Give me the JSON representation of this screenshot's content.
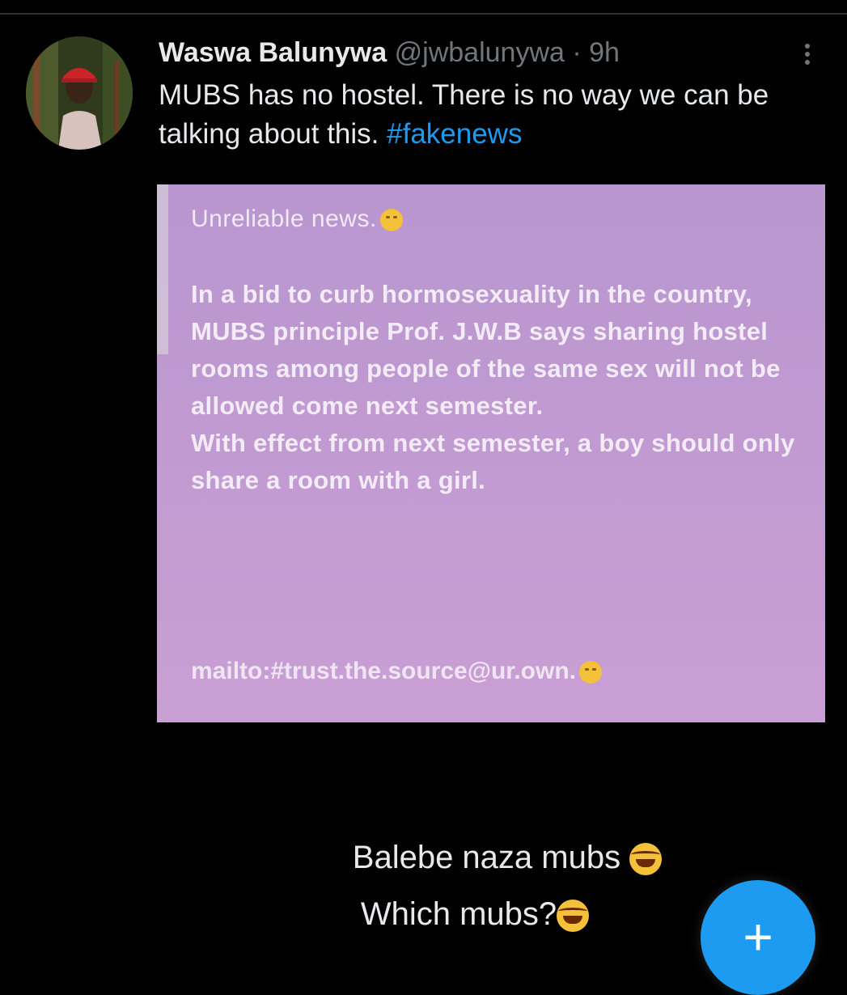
{
  "tweet": {
    "author_name": "Waswa Balunywa",
    "author_handle": "@jwbalunywa",
    "separator": "·",
    "time": "9h",
    "text": "MUBS has no hostel. There is no way we can be talking about this. ",
    "hashtag": "#fakenews"
  },
  "media": {
    "card_title": "Unreliable news.",
    "card_body": [
      "In a bid to curb hormosexuality in the country, MUBS principle Prof. J.W.B says sharing hostel rooms among people of the same sex will not be allowed come next semester.",
      "With effect from next semester, a boy should only share a room with a girl."
    ],
    "card_mail": "mailto:#trust.the.source@ur.own.",
    "caption_line_1": "Balebe naza mubs ",
    "caption_line_2": "Which mubs?"
  },
  "fab": {
    "label": "+"
  },
  "icons": {
    "more": "more-vertical-icon",
    "compose": "plus-icon"
  },
  "colors": {
    "background": "#000000",
    "hashtag": "#1d9bf0",
    "fab": "#1d9bf0",
    "card_purple": "#c39bd3"
  }
}
